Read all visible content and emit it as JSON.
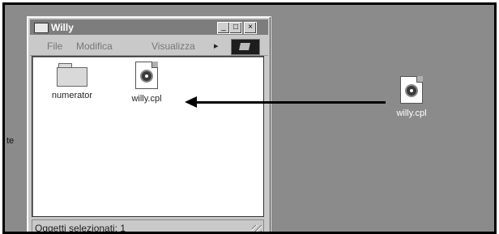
{
  "window": {
    "title": "Willy",
    "controls": {
      "minimize": "_",
      "maximize": "□",
      "close": "×"
    }
  },
  "menu": {
    "items": [
      {
        "label": "File"
      },
      {
        "label": "Modifica"
      },
      {
        "label": "Visualizza"
      }
    ],
    "overflow_arrow": "▸"
  },
  "files": [
    {
      "name": "numerator",
      "icon": "folder-icon"
    },
    {
      "name": "willy.cpl",
      "icon": "control-panel-file-icon"
    }
  ],
  "status": {
    "text": "Oggetti selezionati: 1"
  },
  "desktop": {
    "edge_text": "te",
    "file": {
      "name": "willy.cpl",
      "icon": "control-panel-file-icon"
    }
  },
  "colors": {
    "desktop": "#8b8b8b",
    "window": "#c9c9c9",
    "titlebar": "#7d7d7d"
  }
}
